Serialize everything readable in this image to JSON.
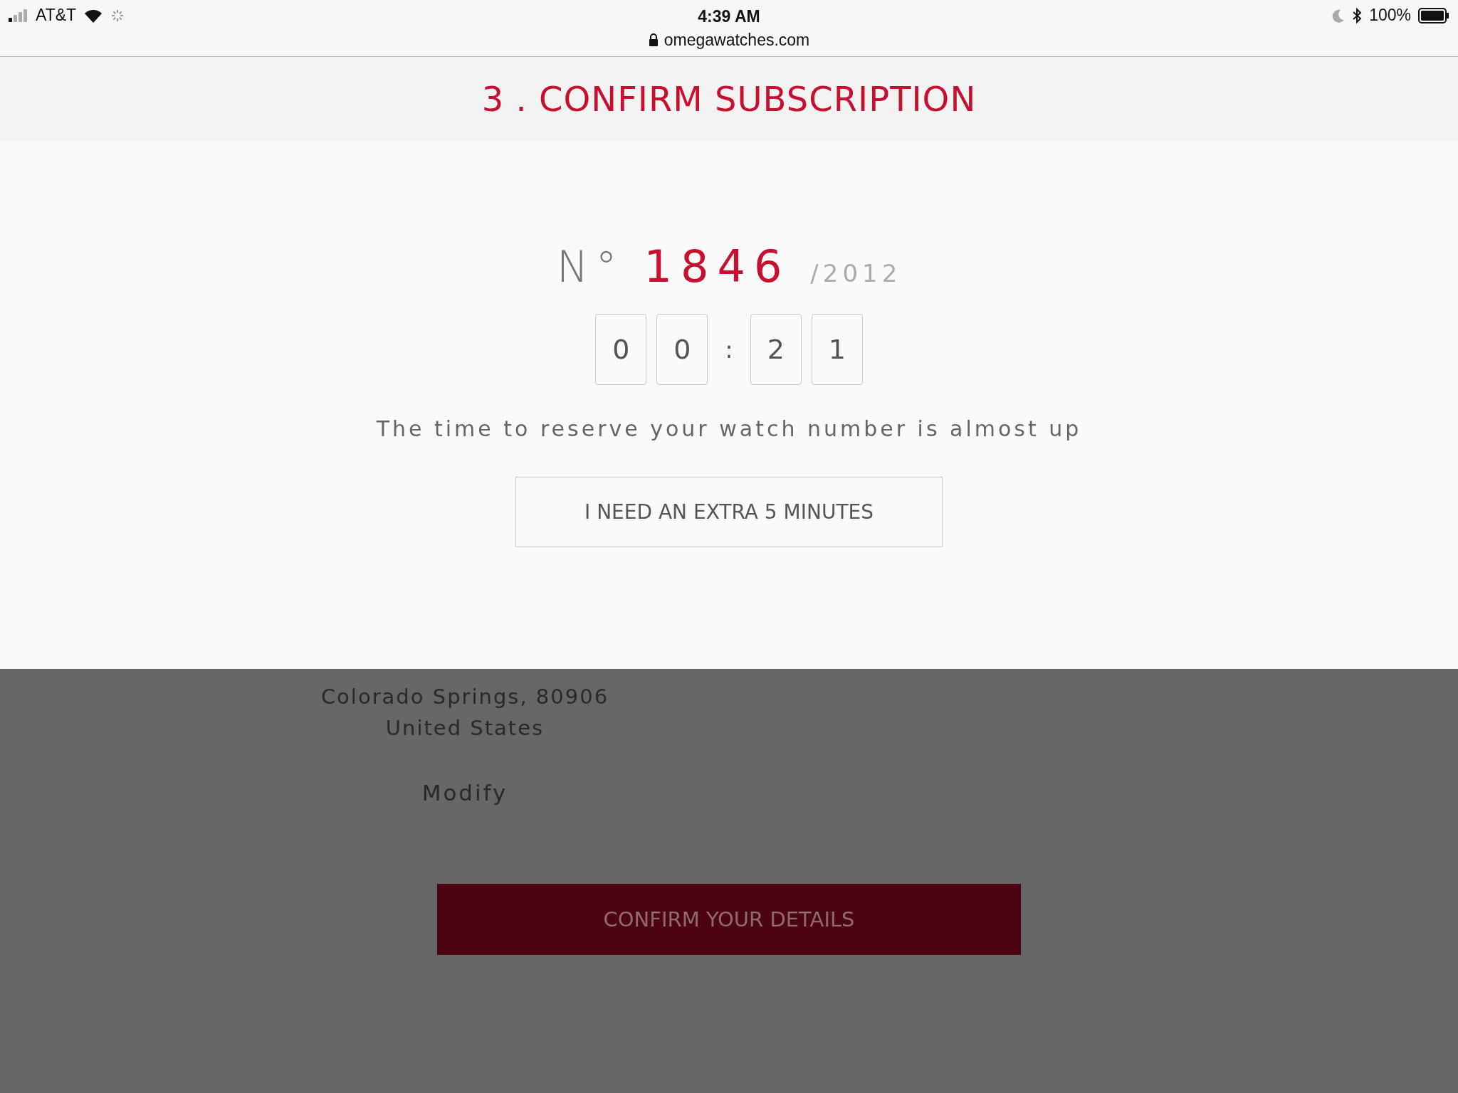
{
  "status_bar": {
    "carrier": "AT&T",
    "time": "4:39 AM",
    "url": "omegawatches.com",
    "battery": "100%"
  },
  "header": {
    "title": "3 . CONFIRM SUBSCRIPTION"
  },
  "modal": {
    "number_prefix": "N°",
    "number": "1846",
    "total": "/2012",
    "countdown": [
      "0",
      "0",
      ":",
      "2",
      "1"
    ],
    "message": "The time to reserve your watch number is almost up",
    "button": "I NEED AN EXTRA 5 MINUTES"
  },
  "background": {
    "address_lines": [
      "Colorado Springs, 80906",
      "United States"
    ],
    "modify_link": "Modify",
    "confirm_button": "CONFIRM YOUR DETAILS"
  }
}
